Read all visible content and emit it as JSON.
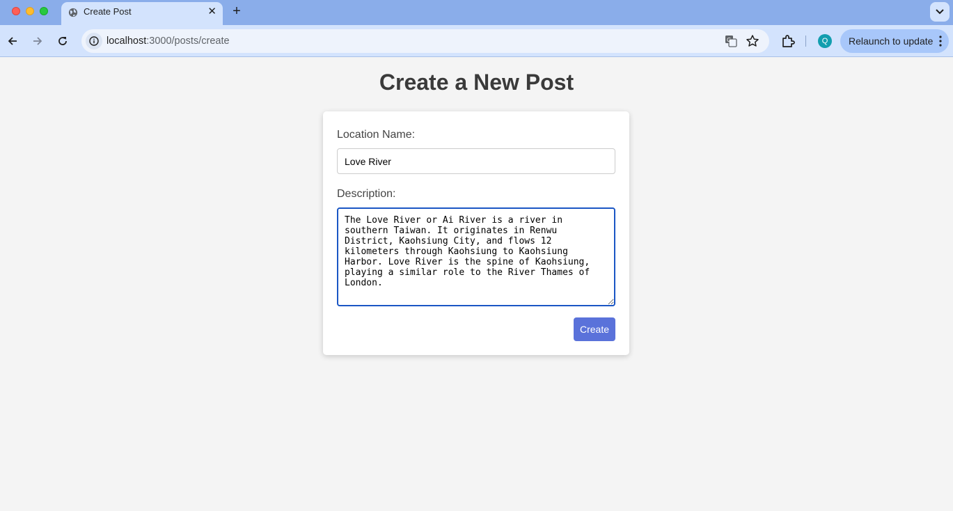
{
  "browser": {
    "tab_title": "Create Post",
    "new_tab_symbol": "+",
    "close_symbol": "✕",
    "url_host": "localhost",
    "url_path": ":3000/posts/create",
    "profile_initial": "Q",
    "relaunch_label": "Relaunch to update"
  },
  "page": {
    "title": "Create a New Post"
  },
  "form": {
    "location_label": "Location Name:",
    "location_value": "Love River",
    "description_label": "Description:",
    "description_value": "The Love River or Ai River is a river in southern Taiwan. It originates in Renwu District, Kaohsiung City, and flows 12 kilometers through Kaohsiung to Kaohsiung Harbor. Love River is the spine of Kaohsiung, playing a similar role to the River Thames of London.",
    "submit_label": "Create"
  },
  "colors": {
    "accent": "#5a72da",
    "focus_border": "#1a56c4",
    "tabbar": "#8aadea",
    "toolbar": "#d3e3fd"
  }
}
